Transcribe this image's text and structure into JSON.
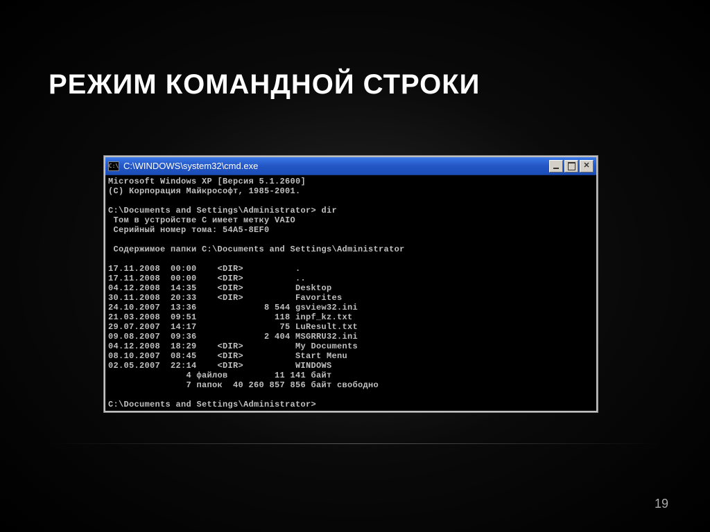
{
  "slide": {
    "title": "РЕЖИМ КОМАНДНОЙ СТРОКИ",
    "number": "19"
  },
  "window": {
    "icon_label": "C:\\",
    "title": "C:\\WINDOWS\\system32\\cmd.exe"
  },
  "terminal": {
    "header_line1": "Microsoft Windows XP [Версия 5.1.2600]",
    "header_line2": "(С) Корпорация Майкрософт, 1985-2001.",
    "prompt1": "C:\\Documents and Settings\\Administrator> dir",
    "vol_line1": " Том в устройстве C имеет метку VAIO",
    "vol_line2": " Серийный номер тома: 54A5-8EF0",
    "content_header": " Содержимое папки C:\\Documents and Settings\\Administrator",
    "rows": [
      "17.11.2008  00:00    <DIR>          .",
      "17.11.2008  00:00    <DIR>          ..",
      "04.12.2008  14:35    <DIR>          Desktop",
      "30.11.2008  20:33    <DIR>          Favorites",
      "24.10.2007  13:36             8 544 gsview32.ini",
      "21.03.2008  09:51               118 inpf_kz.txt",
      "29.07.2007  14:17                75 LuResult.txt",
      "09.08.2007  09:36             2 404 MSGRRU32.ini",
      "04.12.2008  18:29    <DIR>          My Documents",
      "08.10.2007  08:45    <DIR>          Start Menu",
      "02.05.2007  22:14    <DIR>          WINDOWS"
    ],
    "summary1": "               4 файлов         11 141 байт",
    "summary2": "               7 папок  40 260 857 856 байт свободно",
    "prompt2": "C:\\Documents and Settings\\Administrator>"
  }
}
